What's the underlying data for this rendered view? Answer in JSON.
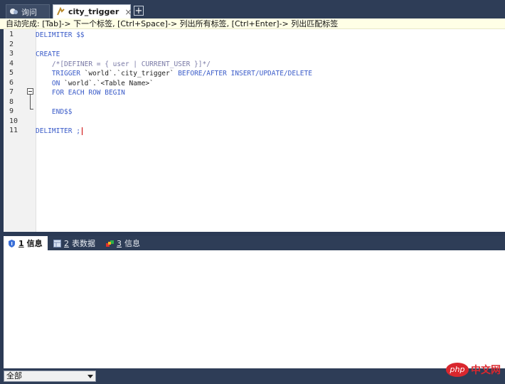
{
  "tabs": [
    {
      "label": "询问",
      "icon": "query-icon"
    },
    {
      "label": "city_trigger",
      "icon": "trigger-icon",
      "close": "×"
    }
  ],
  "add_tab_symbol": "+",
  "autocomplete_hint": "自动完成: [Tab]-> 下一个标签, [Ctrl+Space]-> 列出所有标签, [Ctrl+Enter]-> 列出匹配标签",
  "code": {
    "line_numbers": [
      "1",
      "2",
      "3",
      "4",
      "5",
      "6",
      "7",
      "8",
      "9",
      "10",
      "11"
    ],
    "l1": "DELIMITER $$",
    "l3": "CREATE",
    "l4": "    /*[DEFINER = { user | CURRENT_USER }]*/",
    "l5a": "    TRIGGER ",
    "l5b": "`world`.`city_trigger`",
    "l5c": " BEFORE/AFTER INSERT/UPDATE/DELETE",
    "l6a": "    ON ",
    "l6b": "`world`.`<Table Name>`",
    "l7": "    FOR EACH ROW BEGIN",
    "l9": "    END$$",
    "l11": "DELIMITER ;"
  },
  "result_tabs": [
    {
      "num": "1",
      "label": "信息",
      "icon": "info-icon",
      "active": true
    },
    {
      "num": "2",
      "label": "表数据",
      "icon": "table-data-icon",
      "active": false
    },
    {
      "num": "3",
      "label": "信息",
      "icon": "info-icon",
      "active": false
    }
  ],
  "status": {
    "filter_value": "全部"
  },
  "watermark": {
    "badge": "php",
    "text": "中文网"
  },
  "colors": {
    "keyword": "#3b5cc9",
    "comment": "#7a7aa6",
    "hint_bg": "#ffffe6",
    "frame": "#2e3d57"
  }
}
